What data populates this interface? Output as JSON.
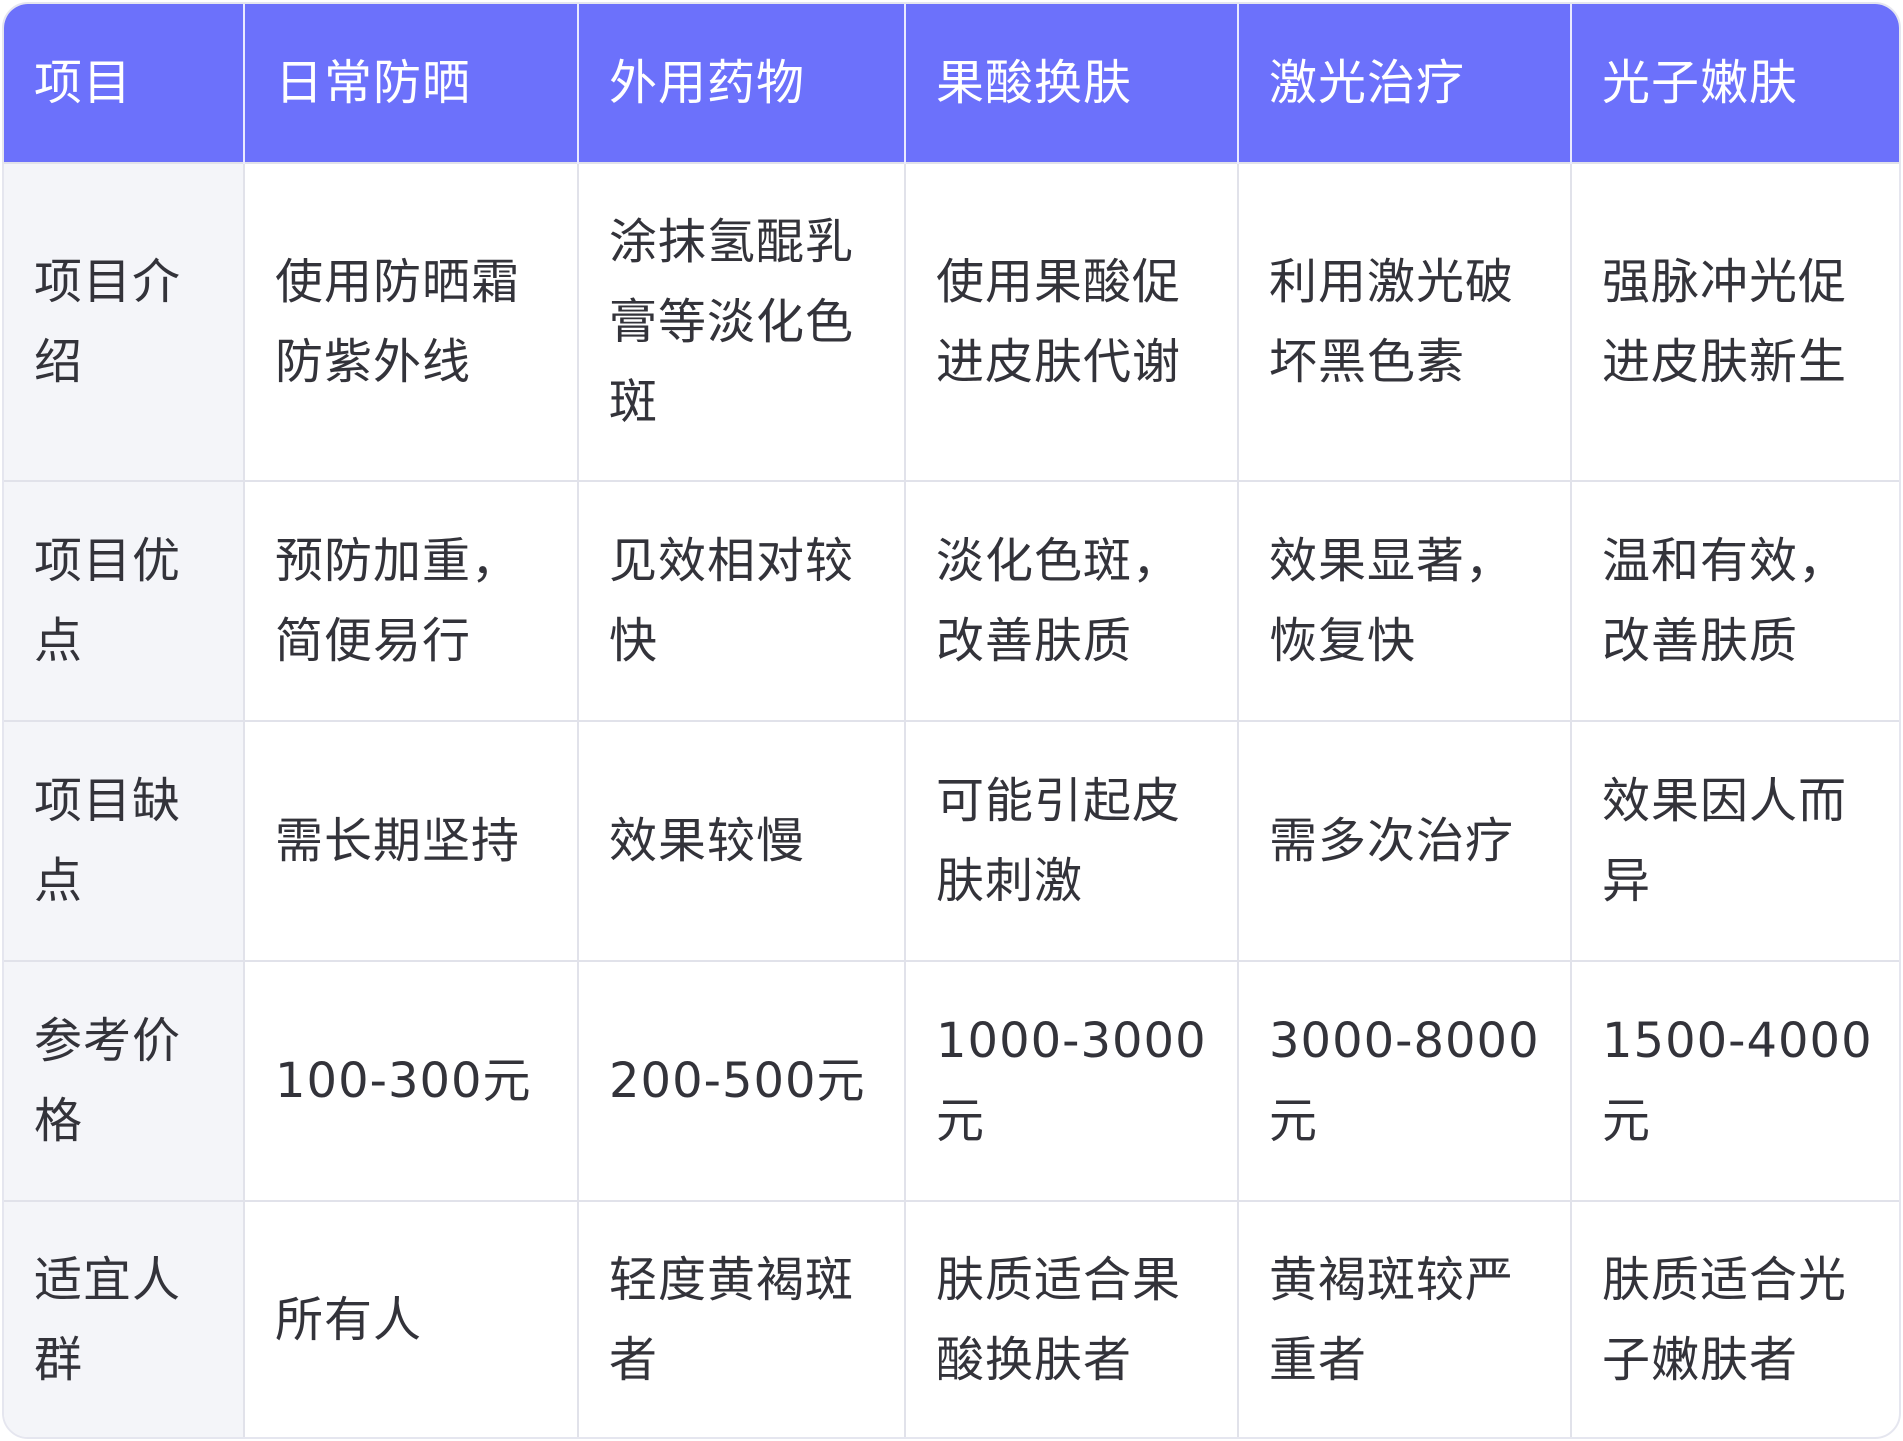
{
  "table": {
    "headers": [
      "项目",
      "日常防晒",
      "外用药物",
      "果酸换肤",
      "激光治疗",
      "光子嫩肤"
    ],
    "rows": [
      {
        "label": "项目介绍",
        "cells": [
          "使用防晒霜防紫外线",
          "涂抹氢醌乳膏等淡化色斑",
          "使用果酸促进皮肤代谢",
          "利用激光破坏黑色素",
          "强脉冲光促进皮肤新生"
        ]
      },
      {
        "label": "项目优点",
        "cells": [
          "预防加重，简便易行",
          "见效相对较快",
          "淡化色斑，改善肤质",
          "效果显著，恢复快",
          "温和有效，改善肤质"
        ]
      },
      {
        "label": "项目缺点",
        "cells": [
          "需长期坚持",
          "效果较慢",
          "可能引起皮肤刺激",
          "需多次治疗",
          "效果因人而异"
        ]
      },
      {
        "label": "参考价格",
        "cells": [
          "100-300元",
          "200-500元",
          "1000-3000元",
          "3000-8000元",
          "1500-4000元"
        ]
      },
      {
        "label": "适宜人群",
        "cells": [
          "所有人",
          "轻度黄褐斑者",
          "肤质适合果酸换肤者",
          "黄褐斑较严重者",
          "肤质适合光子嫩肤者"
        ]
      }
    ]
  },
  "colors": {
    "header_bg": "#6c71fb",
    "header_text": "#ffffff",
    "row_label_bg": "#f4f5f9",
    "body_text": "#33333a",
    "grid_line": "#e1e2ea"
  }
}
